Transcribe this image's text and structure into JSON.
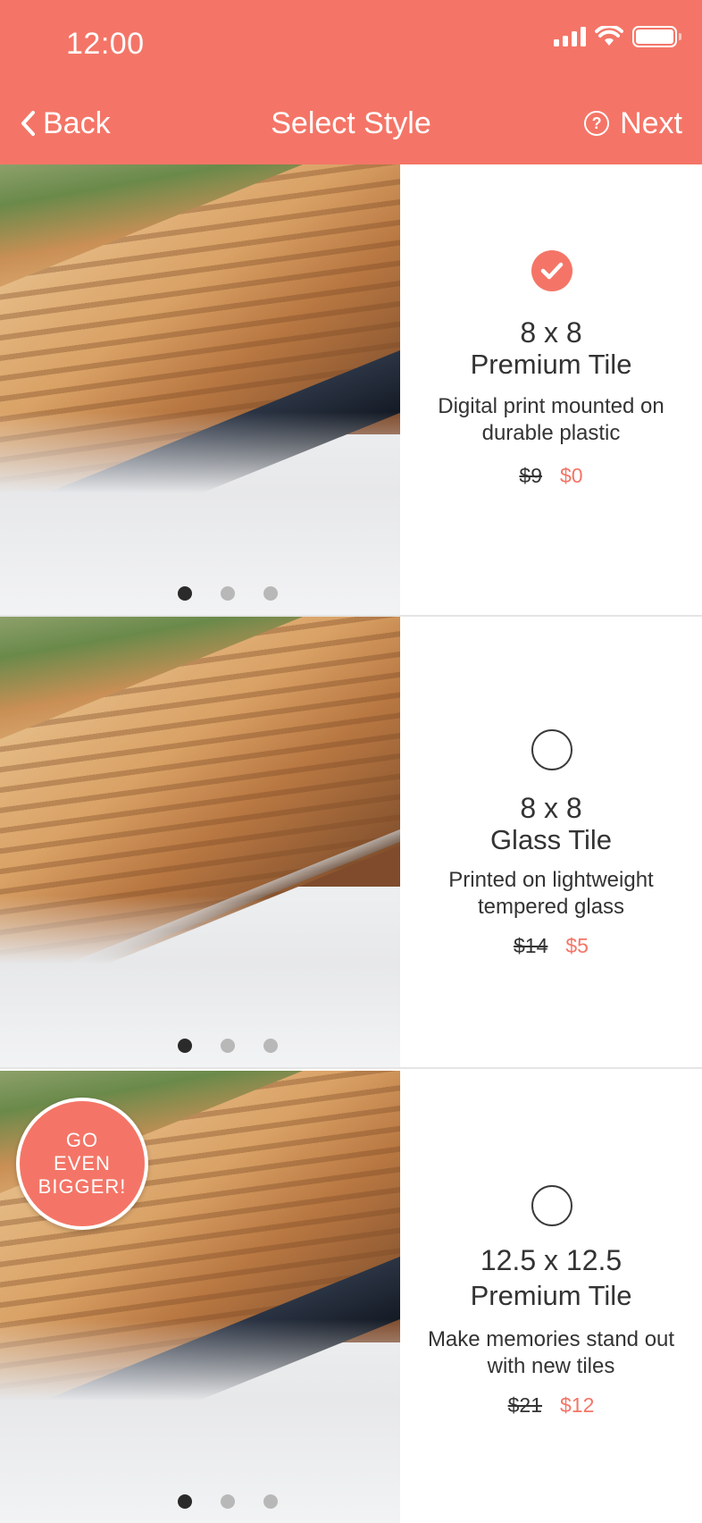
{
  "status_bar": {
    "time": "12:00"
  },
  "nav": {
    "back_label": "Back",
    "title": "Select Style",
    "next_label": "Next"
  },
  "options": [
    {
      "size": "8 x 8",
      "name": "Premium Tile",
      "description": "Digital print mounted on durable plastic",
      "old_price": "$9",
      "new_price": "$0",
      "selected": true
    },
    {
      "size": "8 x 8",
      "name": "Glass Tile",
      "description": "Printed on lightweight tempered glass",
      "old_price": "$14",
      "new_price": "$5",
      "selected": false
    },
    {
      "size": "12.5 x 12.5",
      "name": "Premium Tile",
      "description": "Make memories stand out with new tiles",
      "old_price": "$21",
      "new_price": "$12",
      "selected": false,
      "badge": [
        "GO",
        "EVEN",
        "BIGGER!"
      ]
    }
  ],
  "carousel": {
    "page_count": 3,
    "active_page": 1
  },
  "colors": {
    "accent": "#f47567",
    "text": "#333333",
    "divider": "#e5e5e5"
  }
}
